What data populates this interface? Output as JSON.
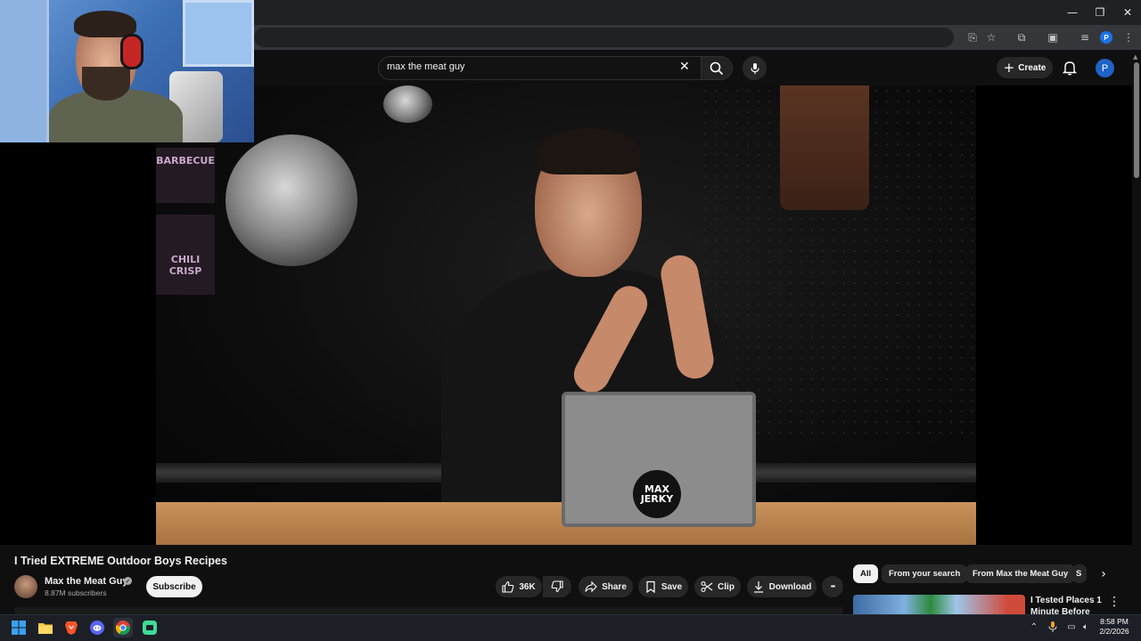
{
  "browser": {
    "window_controls": {
      "minimize": "—",
      "restore": "❐",
      "close": "✕"
    },
    "profile_initial": "P"
  },
  "youtube_header": {
    "search_query": "max the meat guy",
    "create_label": "Create",
    "avatar_initial": "P"
  },
  "video": {
    "tablet_logo_line1": "MAX",
    "tablet_logo_line2": "JERKY",
    "poster1": "BARBECUE",
    "poster2": "CHILI CRISP"
  },
  "watch": {
    "title": "I Tried EXTREME Outdoor Boys Recipes",
    "channel_name": "Max the Meat Guy",
    "verified_glyph": "✓",
    "subscribers": "8.87M subscribers",
    "subscribe_label": "Subscribe",
    "like_count": "36K",
    "share_label": "Share",
    "save_label": "Save",
    "clip_label": "Clip",
    "download_label": "Download",
    "more_glyph": "•••"
  },
  "filter_chips": [
    {
      "label": "All",
      "active": true
    },
    {
      "label": "From your search",
      "active": false
    },
    {
      "label": "From Max the Meat Guy",
      "active": false
    },
    {
      "label": "S",
      "active": false
    }
  ],
  "recommendation": {
    "title": "I Tested Places 1 Minute Before",
    "more_glyph": "⋮"
  },
  "taskbar": {
    "time": "8:58 PM",
    "date": "2/2/2026"
  },
  "colors": {
    "youtube_bg": "#0f0f0f",
    "chrome_bg": "#202124",
    "accent_blue": "#1e63c7",
    "taskbar_bg": "#1c1f26"
  }
}
